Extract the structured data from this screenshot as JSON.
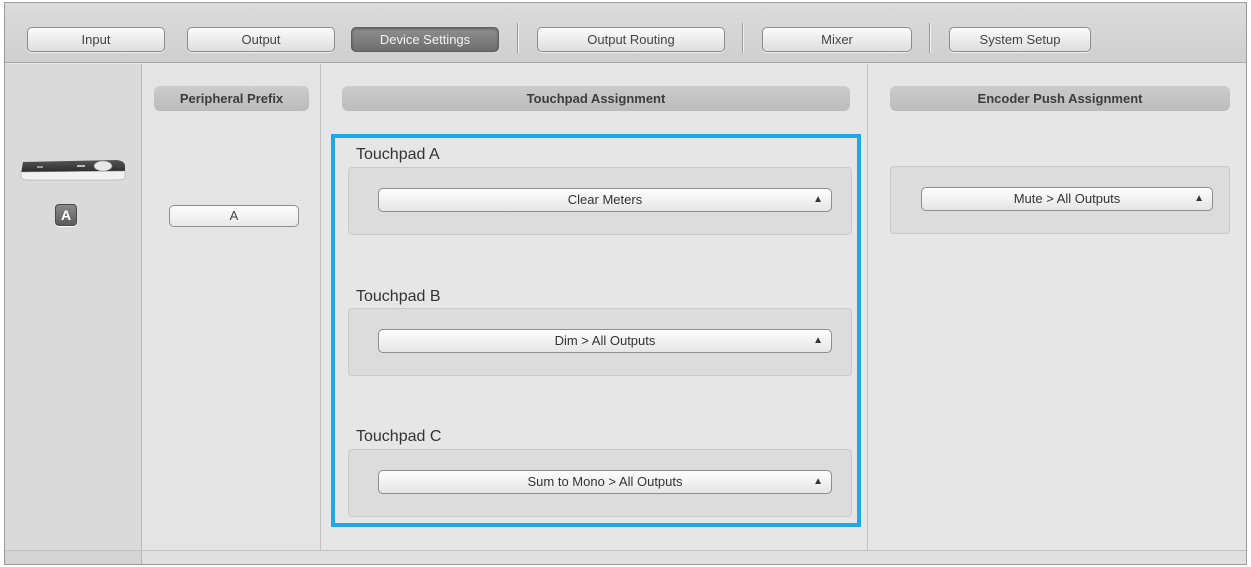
{
  "tabs": [
    {
      "label": "Input",
      "active": false
    },
    {
      "label": "Output",
      "active": false
    },
    {
      "label": "Device Settings",
      "active": true
    },
    {
      "label": "Output Routing",
      "active": false
    },
    {
      "label": "Mixer",
      "active": false
    },
    {
      "label": "System Setup",
      "active": false
    }
  ],
  "device": {
    "badge": "A",
    "icon": "control-surface-icon"
  },
  "prefix": {
    "header": "Peripheral Prefix",
    "value": "A"
  },
  "touchpad": {
    "header": "Touchpad Assignment",
    "items": [
      {
        "label": "Touchpad A",
        "value": "Clear Meters"
      },
      {
        "label": "Touchpad B",
        "value": "Dim > All Outputs"
      },
      {
        "label": "Touchpad C",
        "value": "Sum to Mono > All Outputs"
      }
    ]
  },
  "encoder": {
    "header": "Encoder Push Assignment",
    "value": "Mute > All Outputs"
  },
  "colors": {
    "highlight": "#1ea8e6",
    "active_tab": "#7a7a7a"
  }
}
